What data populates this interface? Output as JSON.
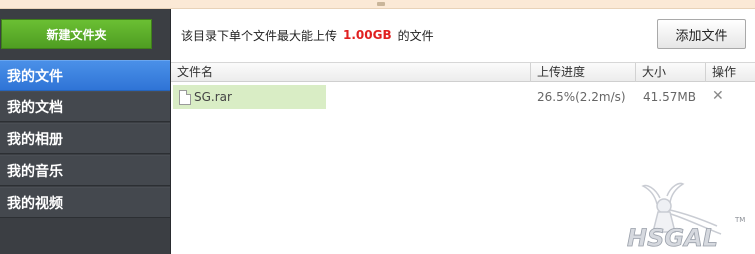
{
  "sidebar": {
    "new_folder_label": "新建文件夹",
    "items": [
      {
        "label": "我的文件",
        "active": true
      },
      {
        "label": "我的文档",
        "active": false
      },
      {
        "label": "我的相册",
        "active": false
      },
      {
        "label": "我的音乐",
        "active": false
      },
      {
        "label": "我的视频",
        "active": false
      }
    ]
  },
  "info": {
    "prefix": "该目录下单个文件最大能上传",
    "limit": "1.00GB",
    "suffix": "的文件",
    "add_file_label": "添加文件"
  },
  "table": {
    "headers": [
      "文件名",
      "上传进度",
      "大小",
      "操作"
    ],
    "rows": [
      {
        "name": "SG.rar",
        "progress": "26.5%(2.2m/s)",
        "size": "41.57MB",
        "action": "✕"
      }
    ]
  },
  "watermark": {
    "text": "HSGAL",
    "tm": "TM"
  },
  "colors": {
    "accent_blue": "#2f74d6",
    "new_folder_green": "#5aad28",
    "limit_red": "#e02020",
    "row_highlight": "#d9edc5"
  }
}
